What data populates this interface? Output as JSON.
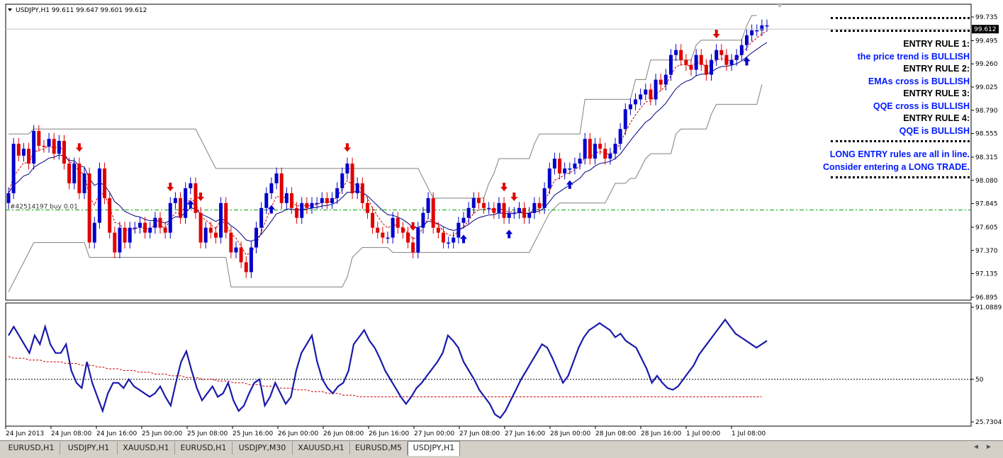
{
  "window": {
    "symbol_label": "USDJPY,H1",
    "ohlc": "99.611 99.647 99.601 99.612",
    "current_price": "99.612",
    "order_label": "#42514197 buy 0.01"
  },
  "rules_panel": {
    "lines": [
      {
        "text": "ENTRY RULE 1:",
        "color": "black"
      },
      {
        "text": "the price trend is BULLISH",
        "color": "blue"
      },
      {
        "text": "ENTRY RULE 2:",
        "color": "black"
      },
      {
        "text": "EMAs cross is BULLISH",
        "color": "blue"
      },
      {
        "text": "ENTRY RULE 3:",
        "color": "black"
      },
      {
        "text": "QQE cross is BULLISH",
        "color": "blue"
      },
      {
        "text": "ENTRY RULE 4:",
        "color": "black"
      },
      {
        "text": "QQE is BULLISH",
        "color": "blue"
      }
    ],
    "summary": [
      "LONG ENTRY rules are all in line.",
      "Consider entering a LONG TRADE."
    ]
  },
  "tabs": [
    {
      "label": "EURUSD,H1",
      "active": false
    },
    {
      "label": "USDJPY,H1",
      "active": false
    },
    {
      "label": "XAUUSD,H1",
      "active": false
    },
    {
      "label": "EURUSD,H1",
      "active": false
    },
    {
      "label": "USDJPY,M30",
      "active": false
    },
    {
      "label": "XAUUSD,H1",
      "active": false
    },
    {
      "label": "EURUSD,M5",
      "active": false
    },
    {
      "label": "USDJPY,H1",
      "active": true
    }
  ],
  "colors": {
    "bull": "#0000cc",
    "bear": "#e00000",
    "channel": "#808080",
    "ema_fast": "#cc0000",
    "ema_slow": "#000080",
    "order_line": "#00a000"
  },
  "chart_data": [
    {
      "type": "candlestick",
      "symbol": "USDJPY",
      "timeframe": "H1",
      "y_ticks": [
        "99.735",
        "99.495",
        "99.260",
        "99.025",
        "98.790",
        "98.555",
        "98.315",
        "98.080",
        "97.845",
        "97.605",
        "97.370",
        "97.135",
        "96.895"
      ],
      "ylim": [
        96.895,
        99.735
      ],
      "order_level": 97.78,
      "x_ticks": [
        "24 Jun 2013",
        "24 Jun 08:00",
        "24 Jun 16:00",
        "25 Jun 00:00",
        "25 Jun 08:00",
        "25 Jun 16:00",
        "26 Jun 00:00",
        "26 Jun 08:00",
        "26 Jun 16:00",
        "27 Jun 00:00",
        "27 Jun 08:00",
        "27 Jun 16:00",
        "28 Jun 00:00",
        "28 Jun 08:00",
        "28 Jun 16:00",
        "1 Jul 00:00",
        "1 Jul 08:00"
      ],
      "close": [
        97.95,
        98.45,
        98.33,
        98.4,
        98.25,
        98.58,
        98.43,
        98.42,
        98.5,
        98.35,
        98.48,
        98.25,
        98.05,
        98.25,
        97.95,
        98.15,
        97.45,
        97.65,
        98.2,
        97.9,
        97.55,
        97.35,
        97.6,
        97.45,
        97.6,
        97.6,
        97.65,
        97.55,
        97.6,
        97.7,
        97.6,
        97.55,
        97.85,
        97.9,
        97.7,
        98.0,
        98.05,
        97.75,
        97.45,
        97.6,
        97.55,
        97.5,
        97.85,
        97.55,
        97.35,
        97.4,
        97.25,
        97.15,
        97.4,
        97.6,
        97.8,
        97.95,
        98.05,
        98.15,
        97.85,
        97.95,
        97.8,
        97.7,
        97.85,
        97.8,
        97.85,
        97.85,
        97.9,
        97.85,
        97.9,
        98.0,
        98.15,
        98.25,
        97.95,
        98.05,
        97.85,
        97.75,
        97.6,
        97.55,
        97.5,
        97.5,
        97.7,
        97.6,
        97.55,
        97.45,
        97.35,
        97.6,
        97.75,
        97.9,
        97.6,
        97.55,
        97.45,
        97.45,
        97.5,
        97.65,
        97.7,
        97.8,
        97.9,
        97.85,
        97.8,
        97.8,
        97.75,
        97.85,
        97.7,
        97.75,
        97.75,
        97.8,
        97.7,
        97.75,
        97.85,
        97.8,
        98.0,
        98.2,
        98.3,
        98.15,
        98.2,
        98.2,
        98.25,
        98.3,
        98.5,
        98.3,
        98.45,
        98.4,
        98.3,
        98.35,
        98.45,
        98.6,
        98.8,
        98.85,
        98.9,
        98.95,
        99.0,
        98.9,
        99.1,
        99.05,
        99.15,
        99.35,
        99.4,
        99.3,
        99.25,
        99.2,
        99.35,
        99.25,
        99.15,
        99.3,
        99.4,
        99.35,
        99.25,
        99.3,
        99.35,
        99.45,
        99.55,
        99.6,
        99.6,
        99.65,
        99.65
      ],
      "down_arrows_at": [
        14,
        32,
        38,
        67,
        80,
        98,
        100,
        140
      ],
      "up_arrows_at": [
        36,
        52,
        90,
        99,
        111,
        146
      ],
      "channel_upper": [
        98.55,
        98.55,
        98.55,
        98.55,
        98.55,
        98.6,
        98.6,
        98.6,
        98.6,
        98.6,
        98.6,
        98.6,
        98.6,
        98.6,
        98.6,
        98.6,
        98.6,
        98.6,
        98.6,
        98.6,
        98.6,
        98.6,
        98.6,
        98.6,
        98.6,
        98.6,
        98.6,
        98.6,
        98.6,
        98.6,
        98.6,
        98.6,
        98.6,
        98.6,
        98.6,
        98.6,
        98.6,
        98.6,
        98.5,
        98.4,
        98.3,
        98.2,
        98.2,
        98.2,
        98.2,
        98.2,
        98.2,
        98.2,
        98.2,
        98.2,
        98.2,
        98.2,
        98.2,
        98.2,
        98.2,
        98.2,
        98.2,
        98.2,
        98.2,
        98.2,
        98.2,
        98.2,
        98.2,
        98.2,
        98.2,
        98.2,
        98.2,
        98.2,
        98.2,
        98.2,
        98.2,
        98.2,
        98.2,
        98.2,
        98.2,
        98.2,
        98.2,
        98.2,
        98.2,
        98.2,
        98.2,
        98.2,
        98.1,
        98.0,
        97.9,
        97.9,
        97.9,
        97.9,
        97.9,
        97.9,
        97.9,
        97.9,
        97.9,
        97.9,
        97.9,
        98.05,
        98.15,
        98.3,
        98.3,
        98.3,
        98.3,
        98.3,
        98.3,
        98.3,
        98.45,
        98.55,
        98.55,
        98.55,
        98.55,
        98.55,
        98.55,
        98.55,
        98.55,
        98.55,
        98.9,
        98.9,
        98.9,
        98.9,
        98.9,
        98.9,
        98.9,
        98.9,
        98.9,
        98.9,
        99.1,
        99.1,
        99.1,
        99.3,
        99.3,
        99.3,
        99.3,
        99.3,
        99.3,
        99.3,
        99.3,
        99.3,
        99.45,
        99.5,
        99.5,
        99.5,
        99.5,
        99.5,
        99.5,
        99.5,
        99.5,
        99.5,
        99.65,
        99.75,
        99.75
      ],
      "channel_lower": [
        96.95,
        97.05,
        97.15,
        97.25,
        97.35,
        97.45,
        97.45,
        97.45,
        97.45,
        97.45,
        97.45,
        97.45,
        97.45,
        97.45,
        97.45,
        97.45,
        97.3,
        97.3,
        97.3,
        97.3,
        97.3,
        97.3,
        97.3,
        97.3,
        97.3,
        97.3,
        97.3,
        97.3,
        97.3,
        97.3,
        97.3,
        97.3,
        97.3,
        97.3,
        97.3,
        97.3,
        97.3,
        97.3,
        97.3,
        97.3,
        97.3,
        97.3,
        97.3,
        97.3,
        97.0,
        97.0,
        97.0,
        97.0,
        97.0,
        97.0,
        97.0,
        97.0,
        97.0,
        97.0,
        97.0,
        97.0,
        97.0,
        97.0,
        97.0,
        97.0,
        97.0,
        97.0,
        97.0,
        97.0,
        97.0,
        97.0,
        97.0,
        97.1,
        97.3,
        97.35,
        97.4,
        97.4,
        97.4,
        97.4,
        97.4,
        97.4,
        97.35,
        97.35,
        97.35,
        97.35,
        97.35,
        97.35,
        97.35,
        97.35,
        97.35,
        97.35,
        97.35,
        97.35,
        97.35,
        97.35,
        97.35,
        97.35,
        97.35,
        97.35,
        97.35,
        97.35,
        97.35,
        97.35,
        97.35,
        97.35,
        97.35,
        97.35,
        97.35,
        97.35,
        97.45,
        97.55,
        97.65,
        97.75,
        97.8,
        97.85,
        97.85,
        97.85,
        97.85,
        97.85,
        97.85,
        97.85,
        97.85,
        97.85,
        97.85,
        97.95,
        98.05,
        98.05,
        98.05,
        98.1,
        98.1,
        98.2,
        98.3,
        98.35,
        98.35,
        98.35,
        98.35,
        98.35,
        98.55,
        98.6,
        98.6,
        98.6,
        98.6,
        98.6,
        98.6,
        98.75,
        98.85,
        98.85,
        98.85,
        98.85,
        98.85,
        98.85,
        98.85,
        98.85,
        98.85,
        99.05
      ]
    },
    {
      "type": "line",
      "indicator": "QQE",
      "y_ticks": [
        "91.0889",
        "50",
        "25.7304"
      ],
      "ylim": [
        25.7304,
        91.0889
      ],
      "reference_level": 50,
      "series": [
        {
          "values": [
            75,
            80,
            75,
            70,
            65,
            75,
            70,
            80,
            70,
            65,
            65,
            70,
            55,
            48,
            45,
            60,
            48,
            40,
            32,
            42,
            48,
            48,
            45,
            50,
            46,
            44,
            42,
            40,
            42,
            46,
            40,
            35,
            48,
            60,
            66,
            55,
            45,
            38,
            42,
            46,
            40,
            42,
            48,
            38,
            32,
            35,
            42,
            48,
            50,
            35,
            40,
            48,
            42,
            36,
            40,
            55,
            65,
            70,
            75,
            60,
            50,
            45,
            42,
            46,
            48,
            55,
            70,
            74,
            78,
            72,
            68,
            62,
            55,
            50,
            45,
            40,
            36,
            40,
            45,
            48,
            52,
            56,
            60,
            65,
            75,
            72,
            68,
            60,
            55,
            50,
            44,
            40,
            36,
            30,
            28,
            32,
            38,
            44,
            50,
            55,
            60,
            65,
            70,
            68,
            62,
            55,
            48,
            52,
            60,
            68,
            74,
            78,
            80,
            82,
            80,
            78,
            74,
            76,
            72,
            70,
            68,
            62,
            56,
            48,
            52,
            48,
            45,
            44,
            46,
            50,
            54,
            58,
            64,
            68,
            72,
            76,
            80,
            84,
            80,
            76,
            74,
            72,
            70,
            68,
            70,
            72
          ]
        },
        {
          "values": [
            63,
            62,
            62,
            62,
            61,
            61,
            61,
            60,
            60,
            60,
            60,
            59,
            59,
            59,
            58,
            58,
            58,
            57,
            57,
            56,
            56,
            56,
            55,
            55,
            55,
            54,
            54,
            54,
            53,
            53,
            53,
            52,
            52,
            52,
            51,
            51,
            51,
            50,
            50,
            50,
            49,
            49,
            49,
            48,
            48,
            48,
            47,
            47,
            47,
            46,
            46,
            46,
            45,
            45,
            45,
            44,
            44,
            44,
            43,
            43,
            43,
            42,
            42,
            42,
            41,
            41,
            41,
            40,
            40,
            40,
            40,
            40,
            40,
            40,
            40,
            40,
            40,
            40,
            40,
            40,
            40,
            40,
            40,
            40,
            40,
            40,
            40,
            40,
            40,
            40,
            40,
            40,
            40,
            40,
            40,
            40,
            40,
            40,
            40,
            40,
            40,
            40,
            40,
            40,
            40,
            40,
            40,
            40,
            40,
            40,
            40,
            40,
            40,
            40,
            40,
            40,
            40,
            40,
            40,
            40,
            40,
            40,
            40,
            40,
            40,
            40,
            40,
            40,
            40,
            40,
            40,
            40,
            40,
            40,
            40,
            40,
            40,
            40,
            40,
            40,
            40,
            40,
            40,
            40,
            40
          ]
        }
      ]
    }
  ]
}
